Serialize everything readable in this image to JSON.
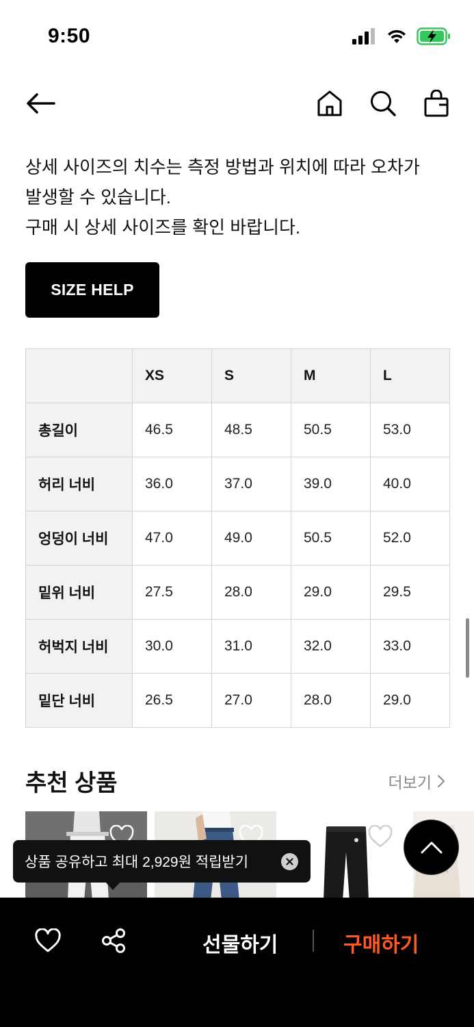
{
  "status_bar": {
    "time": "9:50"
  },
  "notice": {
    "lines": [
      "상세 사이즈의 치수는 측정 방법과 위치에 따라 오차가",
      "발생할 수 있습니다.",
      "구매 시 상세 사이즈를 확인 바랍니다."
    ]
  },
  "size_help_label": "SIZE HELP",
  "size_table": {
    "columns": [
      "XS",
      "S",
      "M",
      "L"
    ],
    "rows": [
      {
        "label": "총길이",
        "values": [
          "46.5",
          "48.5",
          "50.5",
          "53.0"
        ]
      },
      {
        "label": "허리 너비",
        "values": [
          "36.0",
          "37.0",
          "39.0",
          "40.0"
        ]
      },
      {
        "label": "엉덩이 너비",
        "values": [
          "47.0",
          "49.0",
          "50.5",
          "52.0"
        ]
      },
      {
        "label": "밑위 너비",
        "values": [
          "27.5",
          "28.0",
          "29.0",
          "29.5"
        ]
      },
      {
        "label": "허벅지 너비",
        "values": [
          "30.0",
          "31.0",
          "32.0",
          "33.0"
        ]
      },
      {
        "label": "밑단 너비",
        "values": [
          "26.5",
          "27.0",
          "28.0",
          "29.0"
        ]
      }
    ]
  },
  "recommend": {
    "title": "추천 상품",
    "more_label": "더보기"
  },
  "tooltip": {
    "text": "상품 공유하고 최대 2,929원 적립받기"
  },
  "bottom_bar": {
    "gift_label": "선물하기",
    "buy_label": "구매하기"
  },
  "colors": {
    "accent": "#ff5a1f",
    "black": "#000000",
    "table_header_bg": "#f2f2f2"
  }
}
